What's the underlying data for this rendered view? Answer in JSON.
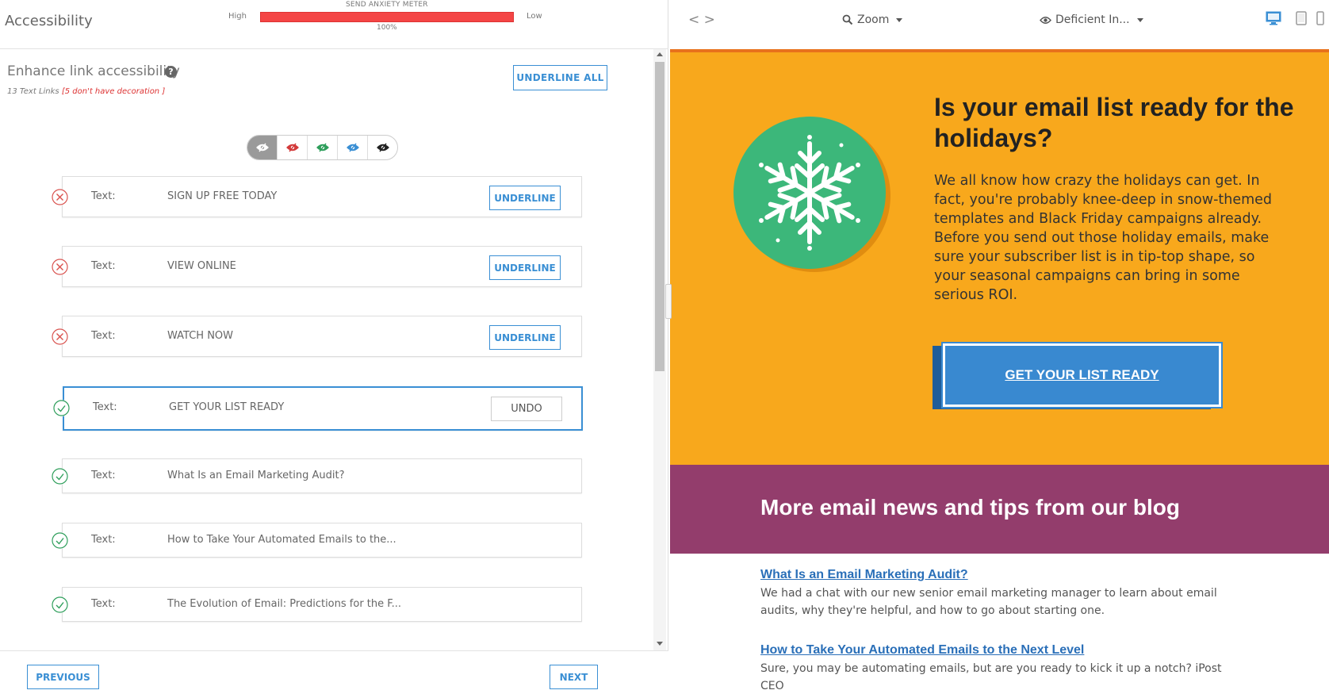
{
  "header": {
    "title": "Accessibility",
    "meter_title": "SEND ANXIETY METER",
    "meter_high": "High",
    "meter_low": "Low",
    "meter_value": "100%",
    "meter_fraction": 1.0
  },
  "section": {
    "title": "Enhance link accessibility",
    "help_icon": "question-circle-icon",
    "count_text": "13 Text Links",
    "count_warn": "[5 don't have decoration ]",
    "underline_all_label": "UNDERLINE ALL"
  },
  "filters": [
    {
      "name": "filter-all",
      "color": "#ffffff",
      "active": true
    },
    {
      "name": "filter-red",
      "color": "#d33a3a",
      "active": false
    },
    {
      "name": "filter-green",
      "color": "#2e9e5b",
      "active": false
    },
    {
      "name": "filter-blue",
      "color": "#3a8fd4",
      "active": false
    },
    {
      "name": "filter-black",
      "color": "#222222",
      "active": false
    }
  ],
  "rows": [
    {
      "status": "error",
      "label": "Text:",
      "text": "SIGN UP FREE TODAY",
      "button": "UNDERLINE"
    },
    {
      "status": "error",
      "label": "Text:",
      "text": "VIEW ONLINE",
      "button": "UNDERLINE"
    },
    {
      "status": "error",
      "label": "Text:",
      "text": "WATCH NOW",
      "button": "UNDERLINE"
    },
    {
      "status": "ok",
      "label": "Text:",
      "text": "GET YOUR LIST READY",
      "button": "UNDO"
    },
    {
      "status": "ok",
      "label": "Text:",
      "text": "What Is an Email Marketing Audit?",
      "button": ""
    },
    {
      "status": "ok",
      "label": "Text:",
      "text": "How to Take Your Automated Emails to the...",
      "button": ""
    },
    {
      "status": "ok",
      "label": "Text:",
      "text": "The Evolution of Email: Predictions for the F...",
      "button": ""
    }
  ],
  "footer": {
    "previous_label": "PREVIOUS",
    "next_label": "NEXT"
  },
  "preview_toolbar": {
    "code_icon": "code-icon",
    "zoom_label": "Zoom",
    "vision_label": "Deficient In...",
    "devices": [
      "desktop-icon",
      "tablet-icon",
      "mobile-icon"
    ]
  },
  "email": {
    "hero_title": "Is your email list ready for the holidays?",
    "hero_body": "We all know how crazy the holidays can get. In fact, you're probably knee-deep in snow-themed templates and Black Friday campaigns already. Before you send out those holiday emails, make sure your subscriber list is in tip-top shape, so your seasonal campaigns can bring in some serious ROI.",
    "cta_label": "GET YOUR LIST READY",
    "blog_title": "More email news and tips from our blog",
    "posts": [
      {
        "title": "What Is an Email Marketing Audit?",
        "desc": "We had a chat with our new senior email marketing manager to learn about email audits, why they're helpful, and how to go about starting one."
      },
      {
        "title": "How to Take Your Automated Emails to the Next Level",
        "desc": "Sure, you may be automating emails, but are you ready to kick it up a notch? iPost CEO"
      }
    ]
  },
  "colors": {
    "accent": "#3a8fd4",
    "error": "#d9534f",
    "ok": "#2e9e5b",
    "hero_bg": "#f8a81c",
    "blog_bg": "#933d6c",
    "cta_bg": "#3989d0"
  }
}
